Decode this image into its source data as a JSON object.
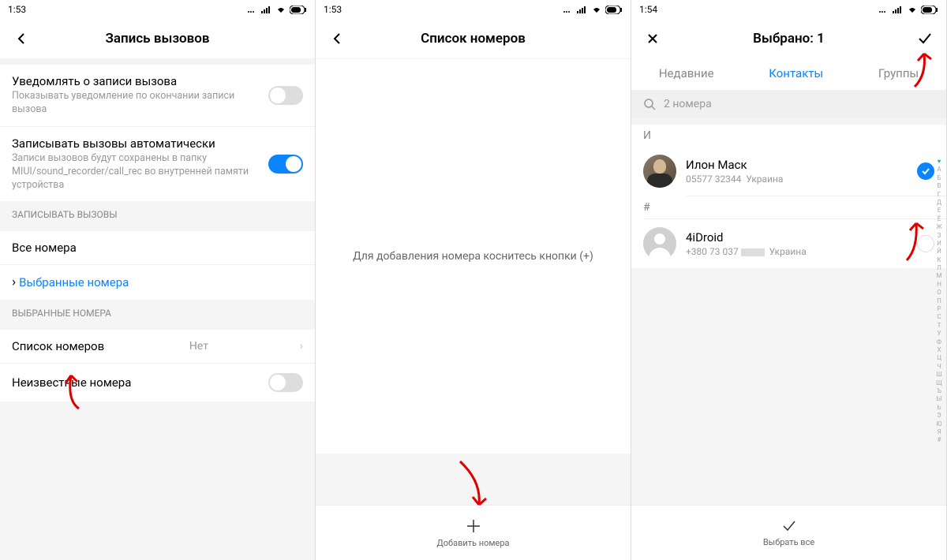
{
  "screen1": {
    "time": "1:53",
    "title": "Запись вызовов",
    "rows": {
      "notify": {
        "title": "Уведомлять о записи вызова",
        "sub": "Показывать уведомление по окончании записи вызова"
      },
      "auto": {
        "title": "Записывать вызовы автоматически",
        "sub": "Записи вызовов будут сохранены в папку MIUI/sound_recorder/call_rec во внутренней памяти устройства"
      }
    },
    "section1_header": "ЗАПИСЫВАТЬ ВЫЗОВЫ",
    "all_numbers": "Все номера",
    "selected_numbers": "Выбранные номера",
    "section2_header": "ВЫБРАННЫЕ НОМЕРА",
    "number_list": "Список номеров",
    "number_list_value": "Нет",
    "unknown_numbers": "Неизвестные номера"
  },
  "screen2": {
    "time": "1:53",
    "title": "Список номеров",
    "empty_text": "Для добавления номера коснитесь кнопки (+)",
    "add_label": "Добавить номера"
  },
  "screen3": {
    "time": "1:54",
    "title": "Выбрано: 1",
    "tabs": {
      "recent": "Недавние",
      "contacts": "Контакты",
      "groups": "Группы"
    },
    "search_placeholder": "2 номера",
    "letter_i": "И",
    "letter_hash": "#",
    "contact1": {
      "name": "Илон Маск",
      "phone": "05577 32344",
      "country": "Украина"
    },
    "contact2": {
      "name": "4iDroid",
      "phone": "+380 73 037",
      "country": "Украина"
    },
    "select_all": "Выбрать все",
    "index": [
      "♥",
      "А",
      "Б",
      "В",
      "Г",
      "Д",
      "Е",
      "Ё",
      "Ж",
      "З",
      "И",
      "Й",
      "К",
      "Л",
      "М",
      "Н",
      "О",
      "П",
      "Р",
      "С",
      "Т",
      "У",
      "Ф",
      "Х",
      "Ц",
      "Ч",
      "Ш",
      "Щ",
      "Ъ",
      "Ы",
      "Ь",
      "Э",
      "Ю",
      "Я",
      "#"
    ]
  }
}
